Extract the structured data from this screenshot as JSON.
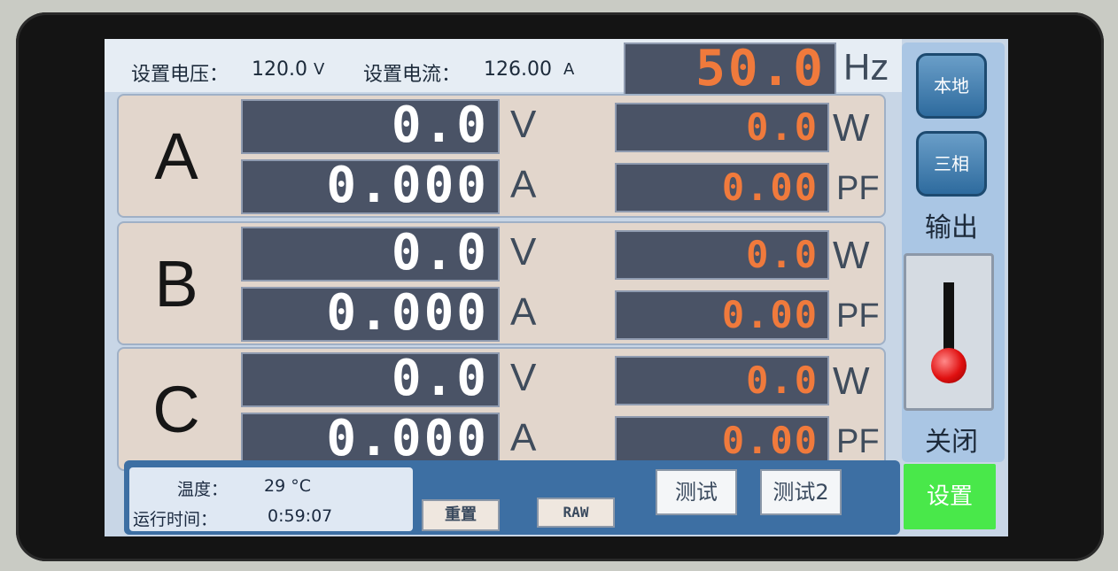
{
  "header": {
    "voltage_label": "设置电压：",
    "voltage_value": "120.0",
    "voltage_unit": "V",
    "current_label": "设置电流：",
    "current_value": "126.00",
    "current_unit": "A",
    "frequency_value": "50.0",
    "frequency_unit": "Hz"
  },
  "phases": [
    {
      "name": "A",
      "voltage": "0.0",
      "voltage_unit": "V",
      "current": "0.000",
      "current_unit": "A",
      "power": "0.0",
      "power_unit": "W",
      "pf": "0.00",
      "pf_unit": "PF"
    },
    {
      "name": "B",
      "voltage": "0.0",
      "voltage_unit": "V",
      "current": "0.000",
      "current_unit": "A",
      "power": "0.0",
      "power_unit": "W",
      "pf": "0.00",
      "pf_unit": "PF"
    },
    {
      "name": "C",
      "voltage": "0.0",
      "voltage_unit": "V",
      "current": "0.000",
      "current_unit": "A",
      "power": "0.0",
      "power_unit": "W",
      "pf": "0.00",
      "pf_unit": "PF"
    }
  ],
  "sidebar": {
    "local_button": "本地",
    "three_phase_button": "三相",
    "output_label": "输出",
    "output_state": "关闭",
    "settings_button": "设置"
  },
  "footer": {
    "temperature_label": "温度：",
    "temperature_value": "29 °C",
    "runtime_label": "运行时间：",
    "runtime_value": "0:59:07",
    "reset_button": "重置",
    "raw_button": "RAW",
    "test_button": "测试",
    "test2_button": "测试2"
  },
  "colors": {
    "display_bg": "#4a5366",
    "value_white": "#ffffff",
    "value_orange": "#f07a3c",
    "panel_bg": "#e2d6cc",
    "settings_green": "#49e84a",
    "indicator_red": "#e01010"
  }
}
